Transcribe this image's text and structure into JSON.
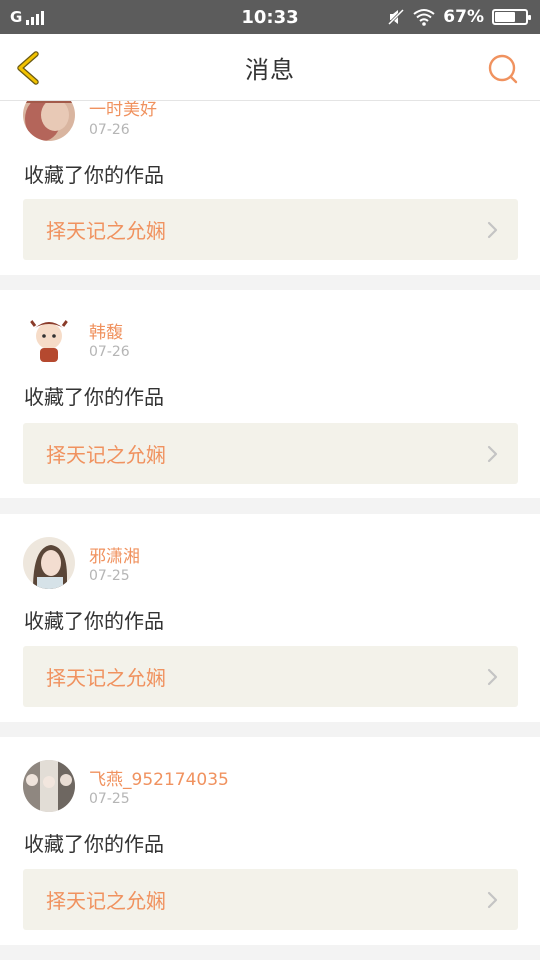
{
  "status_bar": {
    "carrier": "G",
    "time": "10:33",
    "battery_percent": "67%",
    "battery_level": 0.67,
    "icons": [
      "signal-icon",
      "mute-icon",
      "wifi-icon",
      "battery-icon"
    ]
  },
  "header": {
    "title": "消息",
    "back_icon": "chevron-left-icon",
    "search_icon": "search-icon"
  },
  "colors": {
    "accent": "#f0925f",
    "back_arrow": "#f2c200",
    "work_bg": "#f3f2ea"
  },
  "notifications": [
    {
      "user": "一时美好",
      "date": "07-26",
      "action": "收藏了你的作品",
      "work": "择天记之允娴"
    },
    {
      "user": "韩馥",
      "date": "07-26",
      "action": "收藏了你的作品",
      "work": "择天记之允娴"
    },
    {
      "user": "邪潇湘",
      "date": "07-25",
      "action": "收藏了你的作品",
      "work": "择天记之允娴"
    },
    {
      "user": "飞燕_952174035",
      "date": "07-25",
      "action": "收藏了你的作品",
      "work": "择天记之允娴"
    }
  ]
}
